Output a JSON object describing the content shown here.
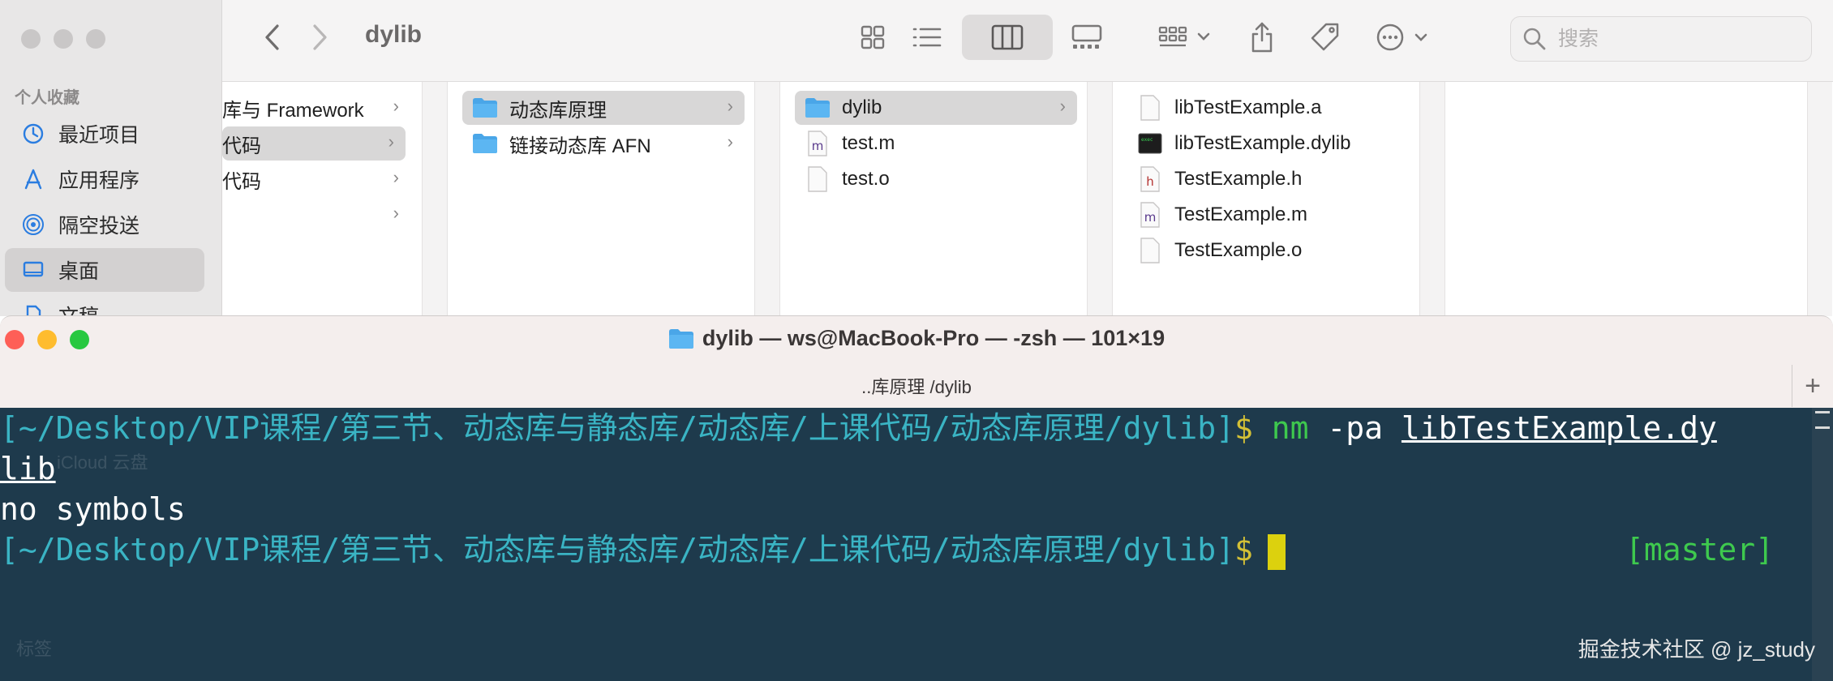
{
  "finder": {
    "title": "dylib",
    "search_placeholder": "搜索",
    "sidebar": {
      "section": "个人收藏",
      "items": [
        {
          "label": "最近项目",
          "icon": "clock-icon"
        },
        {
          "label": "应用程序",
          "icon": "apps-icon"
        },
        {
          "label": "隔空投送",
          "icon": "airdrop-icon"
        },
        {
          "label": "桌面",
          "icon": "desktop-icon",
          "selected": true
        },
        {
          "label": "文稿",
          "icon": "document-icon"
        }
      ]
    },
    "col1": [
      "库与 Framework",
      "代码",
      "代码",
      ""
    ],
    "col2": [
      "动态库原理",
      "链接动态库 AFN"
    ],
    "col3": [
      "dylib",
      "test.m",
      "test.o"
    ],
    "col4": [
      "libTestExample.a",
      "libTestExample.dylib",
      "TestExample.h",
      "TestExample.m",
      "TestExample.o"
    ]
  },
  "terminal": {
    "title": "dylib — ws@MacBook-Pro — -zsh — 101×19",
    "subtitle": "..库原理 /dylib",
    "plus": "+",
    "prompt_path": "[~/Desktop/VIP课程/第三节、动态库与静态库/动态库/上课代码/动态库原理/dylib]",
    "dollar": "$",
    "cmd": "nm",
    "args": "-pa",
    "file_a": "libTestExample.dy",
    "file_b": "lib",
    "output": "no symbols",
    "branch": "[master]",
    "ghost_1": "iCloud 云盘",
    "ghost_2": "标签"
  },
  "watermark": "掘金技术社区 @ jz_study",
  "colors": {
    "terminal_bg": "#1e3a4c",
    "path": "#3ab4c4",
    "command": "#3ec94e",
    "dollar": "#d3c036",
    "cursor": "#dcd10e",
    "folder": "#4aa6e8",
    "close": "#fe5f57",
    "minimize": "#febc2e",
    "zoom": "#28c840"
  }
}
